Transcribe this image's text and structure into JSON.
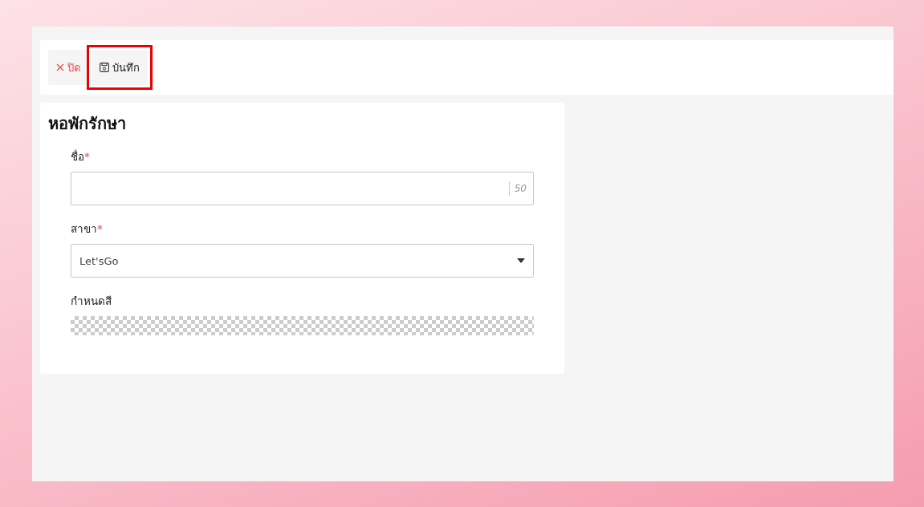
{
  "toolbar": {
    "buttons": [
      {
        "kind": "close",
        "label": "ปิด",
        "highlighted": false
      },
      {
        "kind": "save",
        "label": "บันทึก",
        "highlighted": true
      }
    ]
  },
  "form": {
    "title": "หอพักรักษา",
    "fields": [
      {
        "kind": "text",
        "label": "ชื่อ",
        "required_mark": "*",
        "counter": "50"
      },
      {
        "kind": "select",
        "label": "สาขา",
        "required_mark": "*",
        "value": "Let'sGo"
      },
      {
        "kind": "color",
        "label": "กำหนดสี"
      }
    ]
  }
}
